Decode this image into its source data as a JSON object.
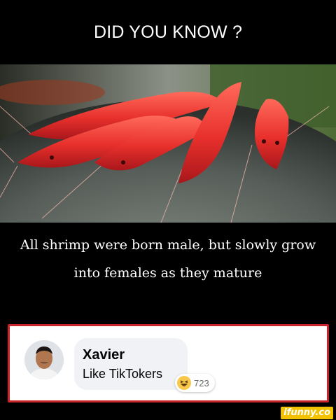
{
  "header": {
    "title": "DID YOU KNOW ?"
  },
  "caption": {
    "text": "All shrimp were born male, but slowly grow into females as they mature"
  },
  "comment": {
    "author": "Xavier",
    "text": "Like TikTokers",
    "reaction_icon": "haha-emoji-icon",
    "reaction_count": "723"
  },
  "watermark": {
    "text": "ifunny.co"
  },
  "colors": {
    "background": "#000000",
    "shrimp": "#e8302c",
    "highlight_border": "#c8242b",
    "watermark": "#f2c200"
  }
}
